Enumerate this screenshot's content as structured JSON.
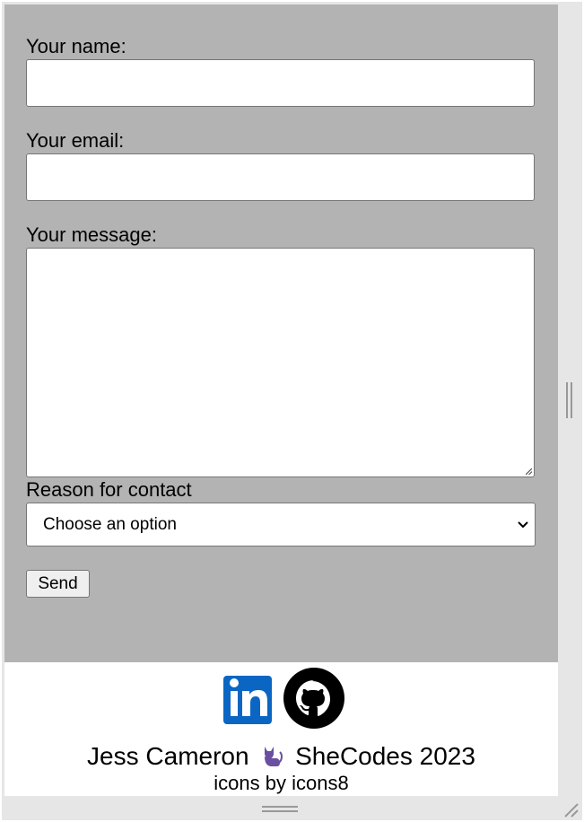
{
  "form": {
    "name_label": "Your name:",
    "name_value": "",
    "email_label": "Your email:",
    "email_value": "",
    "message_label": "Your message:",
    "message_value": "",
    "reason_label": "Reason for contact",
    "reason_selected": "Choose an option",
    "send_label": "Send"
  },
  "footer": {
    "icons": [
      "linkedin-icon",
      "github-icon"
    ],
    "credit_name": "Jess Cameron",
    "credit_icon": "cat-icon",
    "credit_org": "SheCodes 2023",
    "icons_credit": "icons by icons8"
  },
  "colors": {
    "form_background": "#b3b3b3",
    "linkedin_blue": "#0a66c2",
    "cat_purple": "#6a4fa0"
  }
}
